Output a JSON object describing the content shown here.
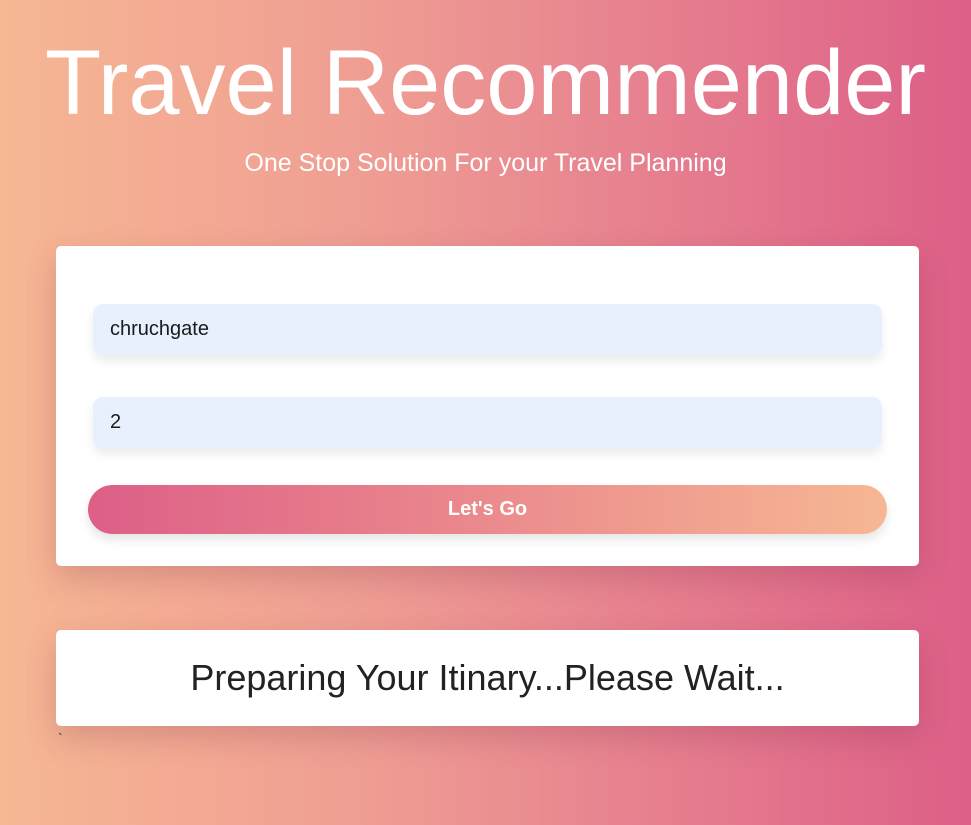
{
  "header": {
    "title": "Travel Recommender",
    "subtitle": "One Stop Solution For your Travel Planning"
  },
  "form": {
    "source_value": "chruchgate",
    "days_value": "2",
    "submit_label": "Let's Go"
  },
  "status": {
    "message": "Preparing Your Itinary...Please Wait..."
  },
  "stray_text": "`",
  "colors": {
    "gradient_start": "#f6b793",
    "gradient_end": "#dd5f87",
    "input_background": "#e8f0fe",
    "card_background": "#ffffff"
  }
}
